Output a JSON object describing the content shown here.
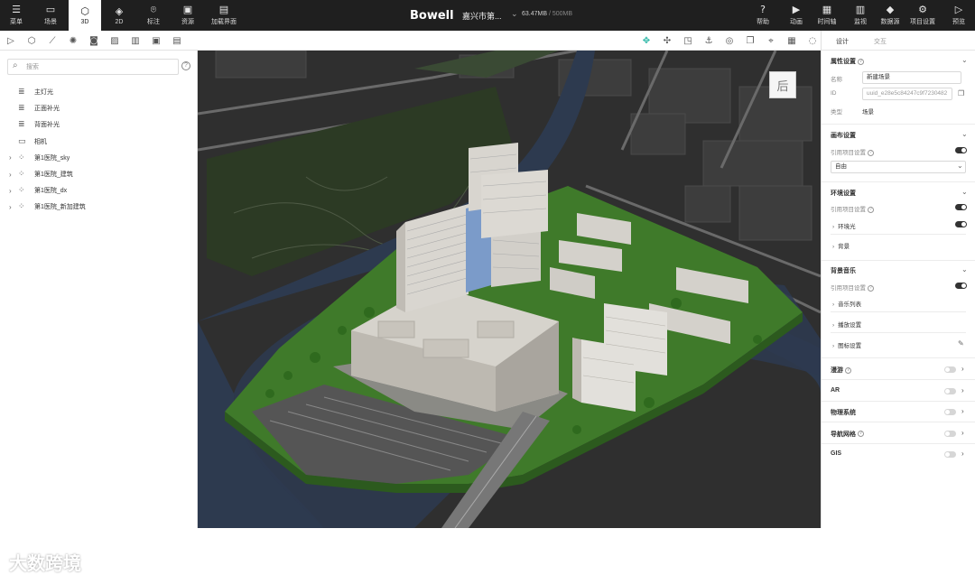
{
  "topbar": {
    "left_items": [
      {
        "label": "菜单",
        "icon": "menu-icon",
        "glyph": "☰"
      },
      {
        "label": "场景",
        "icon": "scene-icon",
        "glyph": "▭"
      },
      {
        "label": "3D",
        "icon": "cube-icon",
        "glyph": "⬡"
      },
      {
        "label": "2D",
        "icon": "layers-icon",
        "glyph": "◈"
      },
      {
        "label": "标注",
        "icon": "pin-icon",
        "glyph": "⌾"
      },
      {
        "label": "资源",
        "icon": "box-icon",
        "glyph": "▣"
      },
      {
        "label": "加载界面",
        "icon": "loading-icon",
        "glyph": "▤"
      }
    ],
    "brand": "Bowell",
    "project_name": "嘉兴市第...",
    "memory_used": "63.47MB",
    "memory_limit": "/ 500MB",
    "right_items": [
      {
        "label": "帮助",
        "icon": "help-icon",
        "glyph": "?"
      },
      {
        "label": "动画",
        "icon": "animation-icon",
        "glyph": "▶"
      },
      {
        "label": "时间轴",
        "icon": "timeline-icon",
        "glyph": "▦"
      },
      {
        "label": "监视",
        "icon": "monitor-icon",
        "glyph": "▥"
      },
      {
        "label": "数据源",
        "icon": "datasource-icon",
        "glyph": "◆"
      },
      {
        "label": "项目设置",
        "icon": "settings-icon",
        "glyph": "⚙"
      },
      {
        "label": "预览",
        "icon": "preview-icon",
        "glyph": "▷"
      }
    ]
  },
  "tools_left": [
    "select-icon",
    "box-icon",
    "line-icon",
    "light-icon",
    "camera-icon",
    "image-icon",
    "chart-icon",
    "frame-icon",
    "panel-icon"
  ],
  "tools_left_glyphs": [
    "▷",
    "⬡",
    "⟋",
    "✺",
    "◙",
    "▨",
    "▥",
    "▣",
    "▤"
  ],
  "tools_right": [
    "move-icon",
    "rotate-icon",
    "scale-icon",
    "anchor-icon",
    "target-icon",
    "copy-icon",
    "focus-icon",
    "grid-icon",
    "more-icon"
  ],
  "tools_right_glyphs": [
    "✥",
    "✣",
    "◳",
    "⚓",
    "◎",
    "❐",
    "⌖",
    "▦",
    "◌"
  ],
  "left_panel": {
    "search_placeholder": "搜索",
    "tree": [
      {
        "label": "主灯光",
        "glyph": "≣",
        "expandable": false
      },
      {
        "label": "正面补光",
        "glyph": "≣",
        "expandable": false
      },
      {
        "label": "背面补光",
        "glyph": "≣",
        "expandable": false
      },
      {
        "label": "相机",
        "glyph": "▭",
        "expandable": false
      },
      {
        "label": "第1医院_sky",
        "glyph": "⁘",
        "expandable": true
      },
      {
        "label": "第1医院_建筑",
        "glyph": "⁘",
        "expandable": true
      },
      {
        "label": "第1医院_dx",
        "glyph": "⁘",
        "expandable": true
      },
      {
        "label": "第1医院_新加建筑",
        "glyph": "⁘",
        "expandable": true
      }
    ],
    "watermark": "大数跨境"
  },
  "viewport": {
    "nav_cube_label": "后"
  },
  "right_panel": {
    "tabs": [
      "设计",
      "交互"
    ],
    "attr_title": "属性设置",
    "name_label": "名称",
    "name_value": "新建场景",
    "id_label": "ID",
    "id_value": "uuid_e28e5c84247c9f7230482",
    "type_label": "类型",
    "type_value": "场景",
    "canvas_title": "画布设置",
    "canvas_ref_label": "引用项目设置",
    "canvas_mode": "自由",
    "env_title": "环境设置",
    "env_ref_label": "引用项目设置",
    "env_ambient": "环境光",
    "env_bg": "背景",
    "bgm_title": "背景音乐",
    "bgm_ref_label": "引用项目设置",
    "bgm_list": "音乐列表",
    "bgm_play": "播放设置",
    "bgm_icon": "图标设置",
    "switches": [
      {
        "label": "漫游",
        "help": true
      },
      {
        "label": "AR",
        "help": false
      },
      {
        "label": "物理系统",
        "help": false
      },
      {
        "label": "导航网格",
        "help": true
      },
      {
        "label": "GIS",
        "help": false
      }
    ]
  }
}
